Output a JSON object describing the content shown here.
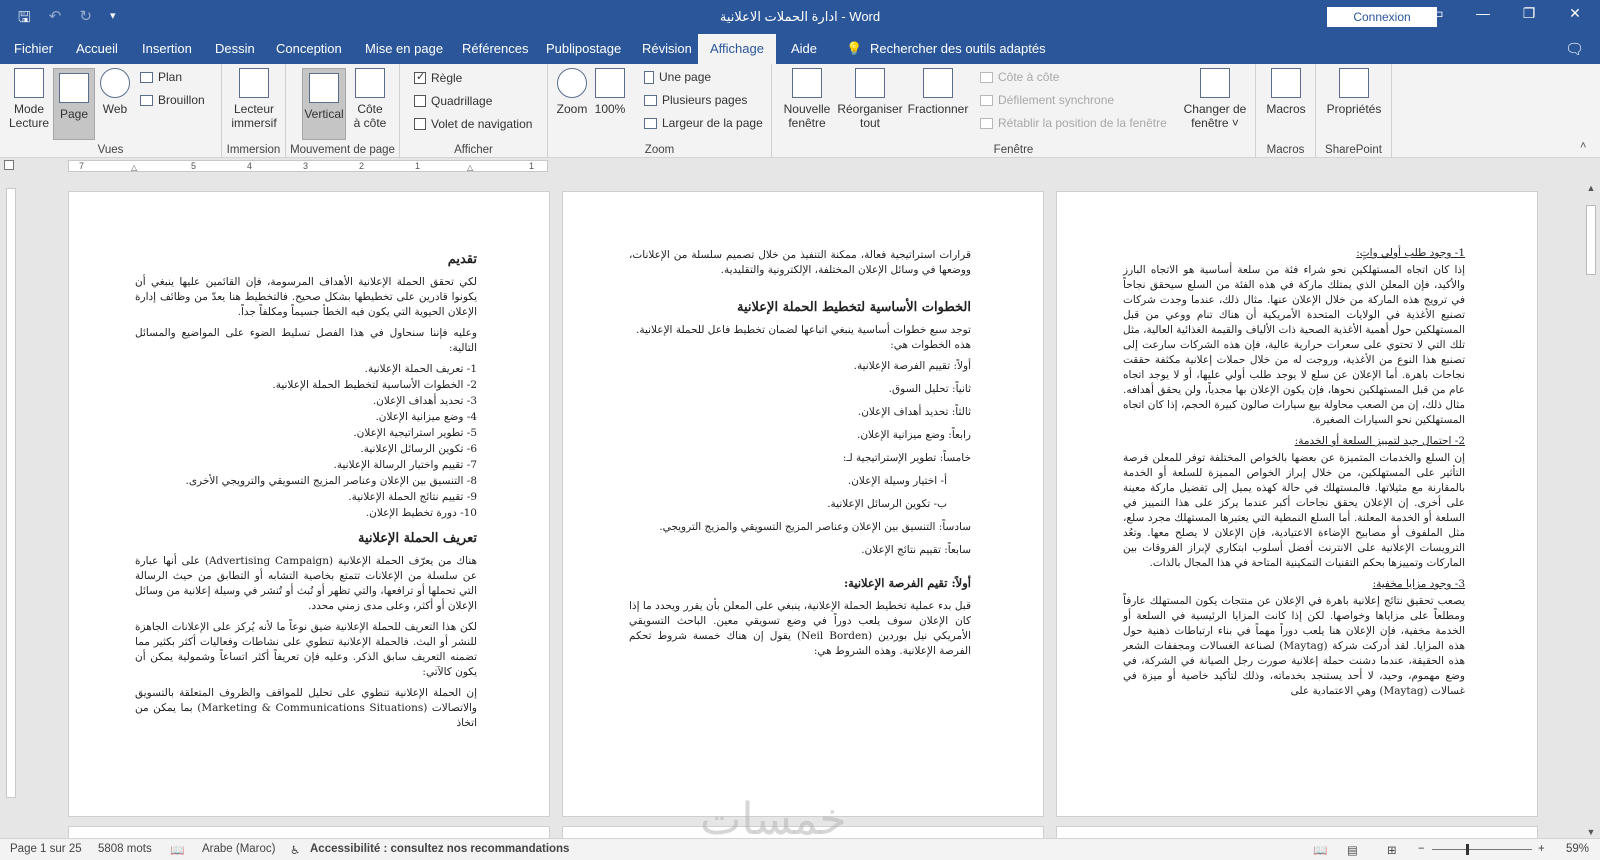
{
  "titlebar": {
    "title": "ادارة الحملات الاعلانية  -  Word",
    "signin_label": "Connexion",
    "save_icon": "save-icon",
    "undo_icon": "undo-icon",
    "redo_icon": "redo-icon"
  },
  "tabs": {
    "items": [
      "Fichier",
      "Accueil",
      "Insertion",
      "Dessin",
      "Conception",
      "Mise en page",
      "Références",
      "Publipostage",
      "Révision",
      "Affichage",
      "Aide"
    ],
    "active": "Affichage",
    "search_label": "Rechercher des outils adaptés"
  },
  "ribbon": {
    "vues": {
      "label": "Vues",
      "mode_lecture": "Mode\nLecture",
      "page": "Page",
      "web": "Web",
      "plan": "Plan",
      "brouillon": "Brouillon"
    },
    "immersion": {
      "label": "Immersion",
      "lecteur": "Lecteur\nimmersif"
    },
    "mouvement": {
      "label": "Mouvement de page",
      "vertical": "Vertical",
      "cote": "Côte\nà côte"
    },
    "afficher": {
      "label": "Afficher",
      "regle": "Règle",
      "quadrillage": "Quadrillage",
      "volet": "Volet de navigation"
    },
    "zoom": {
      "label": "Zoom",
      "zoom": "Zoom",
      "pct": "100%",
      "une_page": "Une page",
      "plusieurs": "Plusieurs pages",
      "largeur": "Largeur de la page"
    },
    "fenetre": {
      "label": "Fenêtre",
      "nouvelle": "Nouvelle\nfenêtre",
      "reorg": "Réorganiser\ntout",
      "fractionner": "Fractionner",
      "cote": "Côte à côte",
      "defilement": "Défilement synchrone",
      "retablir": "Rétablir la position de la fenêtre",
      "changer": "Changer de\nfenêtre ˅"
    },
    "macros": {
      "label": "Macros",
      "macros": "Macros"
    },
    "sharepoint": {
      "label": "SharePoint",
      "proprietes": "Propriétés"
    }
  },
  "ruler": {
    "numbers": [
      "7",
      "6",
      "5",
      "4",
      "3",
      "2",
      "1",
      "1"
    ]
  },
  "pages": {
    "p1": {
      "h_intro": "تقديم",
      "intro": "لكي تحقق الحملة الإعلانية الأهداف المرسومة، فإن القائمين عليها ينبغي أن يكونوا قادرين على تخطيطها بشكل صحيح. فالتخطيط هنا يعدّ من وظائف إدارة الإعلان الحيوية التي يكون فيه الخطأ جسيماً ومكلفاً جداً.",
      "intro2": "وعليه فإننا سنحاول في هذا الفصل تسليط الضوء على المواضيع والمسائل التالية:",
      "list": [
        "1- تعريف الحملة الإعلانية.",
        "2- الخطوات الأساسية لتخطيط الحملة الإعلانية.",
        "3- تحديد أهداف الإعلان.",
        "4- وضع ميزانية الإعلان.",
        "5- تطوير استراتيجية الإعلان.",
        "6- تكوين الرسائل الإعلانية.",
        "7- تقييم واختيار الرسالة الإعلانية.",
        "8- التنسيق بين الإعلان وعناصر المزيج التسويقي والترويجي الأخرى.",
        "9- تقييم نتائج الحملة الإعلانية.",
        "10- دورة تخطيط الإعلان."
      ],
      "h_def": "تعريف الحملة الإعلانية",
      "def1": "هناك من يعرّف الحملة الإعلانية (Advertising Campaign) على أنها عبارة عن سلسلة من الإعلانات تتمتع بخاصية التشابه أو التطابق من حيث الرسالة التي تحملها أو ترافعها، والتي تظهر أو تُبث أو تُنشر في وسيلة إعلانية من وسائل الإعلان أو أكثر، وعلى مدى زمني محدد.",
      "def2": "لكن هذا التعريف للحملة الإعلانية ضيق نوعاً ما لأنه يُركز على الإعلانات الجاهزة للنشر أو البث. فالحملة الإعلانية تنطوي على نشاطات وفعاليات أكثر بكثير مما تضمنه التعريف سابق الذكر. وعليه فإن تعريفاً أكثر اتساعاً وشمولية يمكن أن يكون كالآتي:",
      "def3": "إن الحملة الإعلانية تنطوي على تحليل للمواقف والظروف المتعلقة بالتسويق والاتصالات (Marketing & Communications Situations) بما يمكن من اتخاذ"
    },
    "p2": {
      "top": "قرارات استراتيجية فعالة، ممكنة التنفيذ من خلال تصميم سلسلة من الإعلانات، ووضعها في وسائل الإعلان المختلفة، الإلكترونية والتقليدية.",
      "h_steps": "الخطوات الأساسية لتخطيط الحملة الإعلانية",
      "steps_intro": "توجد سبع خطوات أساسية ينبغي اتباعها لضمان تخطيط فاعل للحملة الإعلانية.",
      "steps_intro2": "هذه الخطوات هي:",
      "steps": [
        "أولاً: تقييم الفرصة الإعلانية.",
        "ثانياً: تحليل السوق.",
        "ثالثاً: تحديد أهداف الإعلان.",
        "رابعاً: وضع ميزانية الإعلان.",
        "خامساً: تطوير الإستراتيجية لـ:",
        "أ- اختيار وسيلة الإعلان.",
        "ب- تكوين الرسائل الإعلانية.",
        "سادساً: التنسيق بين الإعلان وعناصر المزيج التسويقي والمزيج الترويجي.",
        "سابعاً: تقييم نتائج الإعلان."
      ],
      "h_first": "أولاً: تقيم الفرصة الإعلانية:",
      "first": "قبل بدء عملية تخطيط الحملة الإعلانية، ينبغي على المعلن بأن يقرر ويحدد ما إذا كان الإعلان سوف يلعب دوراً في وضع تسويقي معين. الباحث التسويقي الأمريكي نيل بوردين (Neil Borden) يقول إن هناك خمسة شروط تحكم الفرصة الإعلانية. وهذه الشروط هي:"
    },
    "p3": {
      "h1": "1- وجود طلب أولي واتٍ:",
      "t1": "إذا كان اتجاه المستهلكين نحو شراء فئة من سلعة أساسية هو الاتجاه البارز والأكيد، فإن المعلن الذي يمتلك ماركة في هذه الفئة من السلع سيحقق نجاحاً في ترويج هذه الماركة من خلال الإعلان عنها. مثال ذلك، عندما وجدت شركات تصنيع الأغذية في الولايات المتحدة الأمريكية أن هناك تنام ووعي من قبل المستهلكين حول أهمية الأغذية الصحية ذات الألياف والقيمة الغذائية العالية، مثل تلك التي لا تحتوي على سعرات حرارية عالية، فإن هذه الشركات سارعت إلى تصنيع هذا النوع من الأغذية، وروجت له من خلال حملات إعلانية مكثفة حققت نجاحات باهرة. أما الإعلان عن سلع لا يوجد طلب أولي عليها، أو لا يوجد اتجاه عام من قبل المستهلكين نحوها، فإن يكون الإعلان بها مجدياً، ولن يحقق أهدافه. مثال ذلك، إن من الصعب محاولة بيع سيارات صالون كبيرة الحجم، إذا كان اتجاه المستهلكين نحو السيارات الصغيرة.",
      "h2": "2- احتمال جيد لتمييز السلعة أو الخدمة:",
      "t2": "إن السلع والخدمات المتميزة عن بعضها بالخواص المختلفة توفر للمعلن فرصة التأثير على المستهلكين، من خلال إبراز الخواص المميزة للسلعة أو الخدمة بالمقارنة مع مثيلاتها. فالمستهلك في حالة كهذه يميل إلى تفضيل ماركة معينة على أخرى. إن الإعلان يحقق نجاحات أكبر عندما يركز على هذا التمييز في السلعة أو الخدمة المعلنة. أما السلع النمطية التي يعتبرها المستهلك مجرد سلع، مثل الملفوف أو مصابيح الإضاءة الاعتيادية، فإن الإعلان لا يصلح معها. وتعُد الترويسات الإعلانية على الانترنت أفضل أسلوب ابتكاري لإبراز الفروقات بين الماركات وتمييزها بحكم التقنيات التمكينية المتاحة في هذا المجال بالذات.",
      "h3": "3- وجود مزايا مخفية:",
      "t3": "يصعب تحقيق نتائج إعلانية باهرة في الإعلان عن منتجات يكون المستهلك عارفاً ومطلعاً على مزاياها وخواصها. لكن إذا كانت المزايا الرئيسية في السلعة أو الخدمة مخفية، فإن الإعلان هنا يلعب دوراً مهماً في بناء ارتباطات ذهنية حول هذه المزايا. لقد أدركت شركة (Maytag) لصناعة الغسالات ومجففات الشعر هذه الحقيقة، عندما دشنت حملة إعلانية صورت رجل الصيانة في الشركة، في وضع مهموم، وحيد، لا أحد يستنجد بخدماته، وذلك لتأكيد خاصية أو ميزة في غسالات (Maytag) وهي الاعتمادية على"
    }
  },
  "watermark": "خمسات",
  "statusbar": {
    "page": "Page 1 sur 25",
    "words": "5808 mots",
    "language": "Arabe (Maroc)",
    "accessibility": "Accessibilité : consultez nos recommandations",
    "zoom": "59%"
  }
}
